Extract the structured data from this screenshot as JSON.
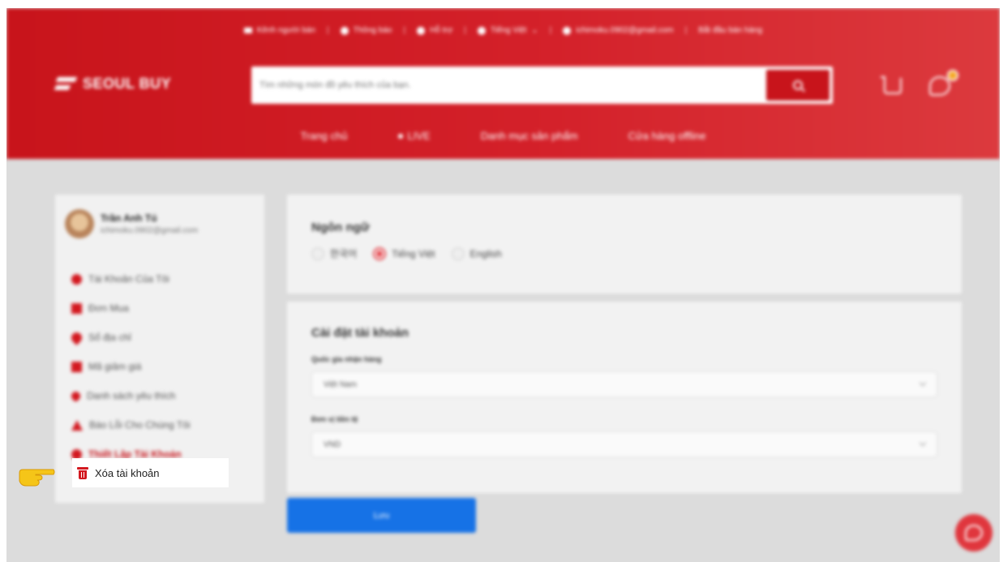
{
  "topbar": {
    "seller_channel": "Kênh người bán",
    "notifications": "Thông báo",
    "support": "Hỗ trợ",
    "language": "Tiếng Việt",
    "email": "ichimoku.0902@gmail.com",
    "start_selling": "Bắt đầu bán hàng"
  },
  "header": {
    "logo_text": "SEOUL BUY",
    "search_placeholder": "Tìm những món đồ yêu thích của bạn.",
    "cart_badge_color": "#f5a623",
    "nav": [
      "Trang chủ",
      "LIVE",
      "Danh mục sản phẩm",
      "Cửa hàng offline"
    ]
  },
  "sidebar": {
    "user_name": "Trần Anh Tú",
    "user_email": "ichimoku.0902@gmail.com",
    "items": [
      {
        "label": "Tài Khoản Của Tôi",
        "icon": "user-icon"
      },
      {
        "label": "Đơn Mua",
        "icon": "document-icon"
      },
      {
        "label": "Sổ địa chỉ",
        "icon": "location-pin-icon"
      },
      {
        "label": "Mã giảm giá",
        "icon": "voucher-icon"
      },
      {
        "label": "Danh sách yêu thích",
        "icon": "heart-icon"
      },
      {
        "label": "Báo Lỗi Cho Chúng Tôi",
        "icon": "warning-icon"
      },
      {
        "label": "Thiết Lập Tài Khoản",
        "icon": "settings-icon"
      }
    ],
    "delete_account": "Xóa tài khoản"
  },
  "language_card": {
    "title": "Ngôn ngữ",
    "options": [
      "한국어",
      "Tiếng Việt",
      "English"
    ],
    "selected": "Tiếng Việt"
  },
  "account_card": {
    "title": "Cài đặt tài khoản",
    "country_label": "Quốc gia nhận hàng",
    "country_value": "Việt Nam",
    "currency_label": "Đơn vị tiền tệ",
    "currency_value": "VND"
  },
  "save_label": "Lưu",
  "colors": {
    "brand_red": "#c8141b",
    "save_blue": "#1672e6",
    "pointer_yellow": "#f5c518"
  }
}
